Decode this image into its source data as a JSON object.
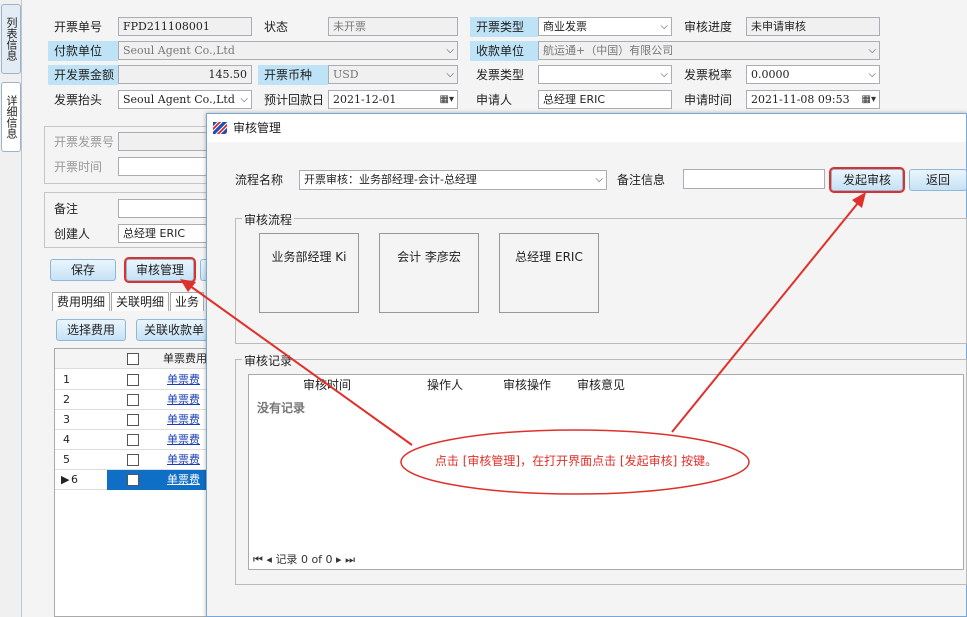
{
  "side_tabs": [
    "列表信息",
    "详细信息"
  ],
  "form": {
    "invoice_no_label": "开票单号",
    "invoice_no": "FPD211108001",
    "status_label": "状态",
    "status": "未开票",
    "invoice_type_label": "开票类型",
    "invoice_type": "商业发票",
    "audit_progress_label": "审核进度",
    "audit_progress": "未申请审核",
    "payer_label": "付款单位",
    "payer": "Seoul Agent Co.,Ltd",
    "payee_label": "收款单位",
    "payee": "航运通+（中国）有限公司",
    "amount_label": "开发票金额",
    "amount": "145.50",
    "currency_label": "开票币种",
    "currency": "USD",
    "bill_type_label": "发票类型",
    "bill_type": "",
    "tax_rate_label": "发票税率",
    "tax_rate": "0.0000",
    "header_label": "发票抬头",
    "header": "Seoul Agent Co.,Ltd",
    "due_date_label": "预计回款日",
    "due_date": "2021-12-01",
    "applicant_label": "申请人",
    "applicant": "总经理 ERIC",
    "apply_time_label": "申请时间",
    "apply_time": "2021-11-08 09:53",
    "issued_no_label": "开票发票号",
    "issued_time_label": "开票时间",
    "remark_label": "备注",
    "creator_label": "创建人",
    "creator": "总经理 ERIC"
  },
  "actions": {
    "save": "保存",
    "audit_manage": "审核管理"
  },
  "tabs": [
    "费用明细",
    "关联明细",
    "业务"
  ],
  "sub_actions": {
    "select_fee": "选择费用",
    "link_receipt": "关联收款单"
  },
  "grid": {
    "col_header": "单票费用",
    "row_numbers": [
      "1",
      "2",
      "3",
      "4",
      "5",
      "6"
    ],
    "row_link": "单票费",
    "current_marker": "▶"
  },
  "dialog": {
    "title": "审核管理",
    "flow_label": "流程名称",
    "flow_value": "开票审核：业务部经理-会计-总经理",
    "remark_label": "备注信息",
    "start_button": "发起审核",
    "back_button": "返回",
    "flow_group": "审核流程",
    "nodes": [
      "业务部经理 Ki",
      "会计 李彦宏",
      "总经理 ERIC"
    ],
    "record_group": "审核记录",
    "record_headers": [
      "审核时间",
      "操作人",
      "审核操作",
      "审核意见"
    ],
    "empty_text": "没有记录",
    "pager": {
      "record_label": "记录",
      "from": "0",
      "of": "of",
      "total": "0"
    }
  },
  "annotation": "点击 [审核管理]，在打开界面点击 [发起审核] 按键。",
  "colors": {
    "highlight_label": "#bfe3f6",
    "red_mark": "#e0302a",
    "selected_row": "#0f6fc6"
  }
}
